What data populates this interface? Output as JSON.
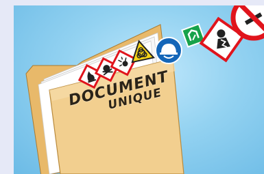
{
  "folder": {
    "label_line1": "DOCUMENT",
    "label_line2": "UNIQUE"
  },
  "colors": {
    "background_outer": "#e6e9f7",
    "sky_light": "#bfe7fb",
    "sky_dark": "#6cbbe6",
    "folder": "#f2cf8f",
    "folder_edge": "#b98a3c",
    "warning_yellow": "#f7d417",
    "hazard_red": "#e0141c",
    "mandatory_blue": "#1466b8",
    "safe_green": "#17a24a"
  },
  "icons": [
    "flammable-pictogram-icon",
    "toxic-skull-pictogram-icon",
    "explosive-pictogram-icon",
    "biohazard-sign-icon",
    "hard-hat-mandatory-sign-icon",
    "green-safety-sign-icon",
    "health-hazard-pictogram-icon",
    "no-smoking-sign-icon"
  ]
}
